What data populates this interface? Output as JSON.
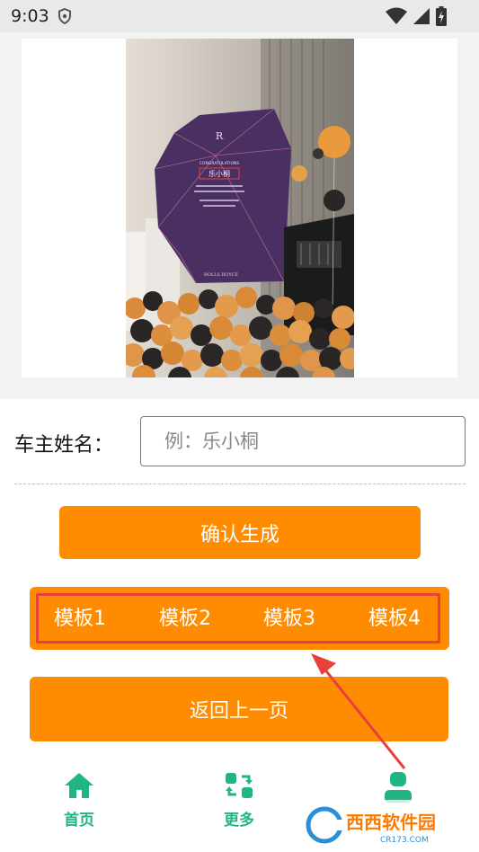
{
  "status_bar": {
    "time": "9:03",
    "icons": [
      "shield-icon",
      "wifi-icon",
      "signal-icon",
      "battery-icon"
    ]
  },
  "photo": {
    "board_heading": "CONGRATULATIONS",
    "board_name": "乐小桐",
    "brand": "ROLLS ROYCE"
  },
  "form": {
    "name_label": "车主姓名：",
    "name_placeholder": "例：乐小桐"
  },
  "buttons": {
    "confirm": "确认生成",
    "back": "返回上一页"
  },
  "templates": [
    "模板1",
    "模板2",
    "模板3",
    "模板4"
  ],
  "tabs": [
    {
      "label": "首页",
      "icon": "home-icon"
    },
    {
      "label": "更多",
      "icon": "swap-icon"
    },
    {
      "label": "",
      "icon": "user-icon"
    }
  ],
  "watermark": {
    "brand": "西西软件园",
    "url": "CR173.COM"
  },
  "colors": {
    "accent": "#ff8c00",
    "tab_green": "#22b584",
    "highlight": "#e8413c"
  }
}
